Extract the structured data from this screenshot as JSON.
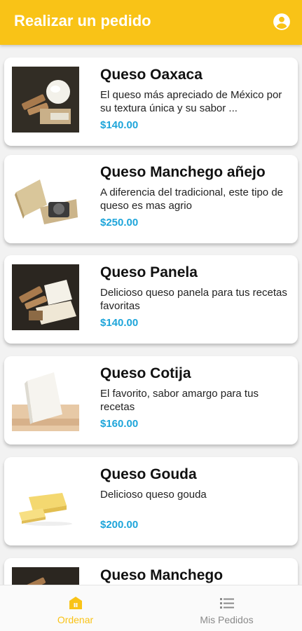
{
  "appbar": {
    "title": "Realizar un pedido",
    "account_icon": "account-circle-icon"
  },
  "colors": {
    "primary": "#f9c317",
    "price": "#1ea5da",
    "nav_inactive": "#8a8a8a"
  },
  "products": [
    {
      "name": "Queso Oaxaca",
      "description": "El queso más apreciado de México por su textura única y su sabor ...",
      "price": "$140.00"
    },
    {
      "name": "Queso Manchego añejo",
      "description": "A diferencia del tradicional, este tipo de queso es mas agrio",
      "price": "$250.00"
    },
    {
      "name": "Queso Panela",
      "description": "Delicioso queso panela para tus recetas favoritas",
      "price": "$140.00"
    },
    {
      "name": "Queso Cotija",
      "description": "El favorito, sabor amargo para tus recetas",
      "price": "$160.00"
    },
    {
      "name": "Queso Gouda",
      "description": "Delicioso queso gouda",
      "price": "$200.00"
    },
    {
      "name": "Queso Manchego",
      "description": "",
      "price": ""
    }
  ],
  "bottom_nav": {
    "items": [
      {
        "label": "Ordenar",
        "icon": "store-icon",
        "active": true
      },
      {
        "label": "Mis Pedidos",
        "icon": "list-icon",
        "active": false
      }
    ]
  }
}
